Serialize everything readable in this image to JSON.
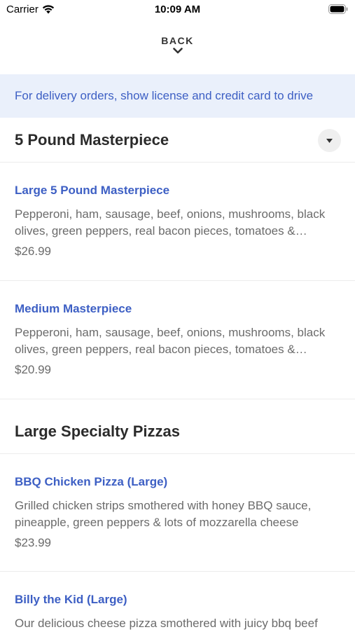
{
  "status_bar": {
    "carrier": "Carrier",
    "time": "10:09 AM"
  },
  "nav": {
    "back_label": "BACK"
  },
  "banner": {
    "text": "For delivery orders, show license and credit card to drive"
  },
  "sections": [
    {
      "title": "5 Pound Masterpiece",
      "items": [
        {
          "name": "Large 5 Pound Masterpiece",
          "description": "Pepperoni, ham, sausage, beef, onions, mushrooms, black olives, green peppers, real bacon pieces, tomatoes & pineapple",
          "price": "$26.99"
        },
        {
          "name": "Medium Masterpiece",
          "description": "Pepperoni, ham, sausage, beef, onions, mushrooms, black olives, green peppers, real bacon pieces, tomatoes & pineapple",
          "price": "$20.99"
        }
      ]
    },
    {
      "title": "Large Specialty Pizzas",
      "items": [
        {
          "name": "BBQ Chicken Pizza (Large)",
          "description": "Grilled chicken strips smothered with honey BBQ sauce, pineapple, green peppers & lots of mozzarella cheese",
          "price": "$23.99"
        },
        {
          "name": "Billy the Kid (Large)",
          "description": "Our delicious cheese pizza smothered with juicy bbq beef"
        }
      ]
    }
  ],
  "colors": {
    "accent": "#3d5fc4",
    "banner_bg": "#eaf0fb"
  }
}
